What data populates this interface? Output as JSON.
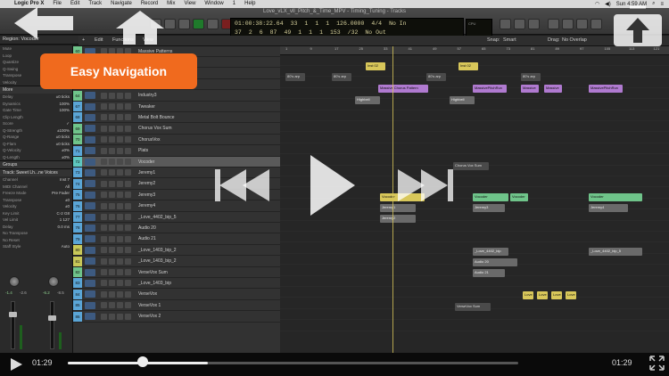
{
  "menubar": {
    "items": [
      "Logic Pro X",
      "File",
      "Edit",
      "Track",
      "Navigate",
      "Record",
      "Mix",
      "View",
      "Window",
      "1",
      "Help"
    ],
    "clock": "Sun 4:59 AM"
  },
  "window": {
    "title": "Love_vLX_vll_Pitch_&_Time_MPV - Timing_Tuning - Tracks"
  },
  "lcd": {
    "row1": [
      "01:00:38:22.64",
      "33",
      "1",
      "1",
      "1",
      "126.0000",
      "4/4",
      "No In"
    ],
    "row2": [
      "37",
      "2",
      "6",
      "87",
      "49",
      "1",
      "1",
      "1",
      "153",
      "/32",
      "No Out"
    ],
    "cpu_label": "CPU"
  },
  "inspector": {
    "region_label": "Region: Vocoder",
    "params": [
      {
        "k": "Mute",
        "v": ""
      },
      {
        "k": "Loop",
        "v": ""
      },
      {
        "k": "Quantize",
        "v": "off"
      },
      {
        "k": "Q-Swing",
        "v": ""
      },
      {
        "k": "Transpose",
        "v": ""
      },
      {
        "k": "Velocity",
        "v": "±0"
      }
    ],
    "more_label": "More",
    "more_params": [
      {
        "k": "Delay",
        "v": "±0 ticks"
      },
      {
        "k": "Dynamics",
        "v": "100%"
      },
      {
        "k": "Gate Time",
        "v": "100%"
      },
      {
        "k": "Clip Length",
        "v": ""
      },
      {
        "k": "Score",
        "v": "✓"
      },
      {
        "k": "Q-Strength",
        "v": "±100%"
      },
      {
        "k": "Q-Range",
        "v": "±0 ticks"
      },
      {
        "k": "Q-Flam",
        "v": "±0 ticks"
      },
      {
        "k": "Q-Velocity",
        "v": "±0%"
      },
      {
        "k": "Q-Length",
        "v": "±0%"
      }
    ],
    "groups_label": "Groups",
    "track_label": "Track: Sweet Lh...ne Voices",
    "track_params": [
      {
        "k": "Channel",
        "v": "Inst 7"
      },
      {
        "k": "MIDI Channel",
        "v": "All"
      },
      {
        "k": "Freeze Mode",
        "v": "Pre Fader"
      },
      {
        "k": "Transpose",
        "v": "±0"
      },
      {
        "k": "Velocity",
        "v": "±0"
      },
      {
        "k": "Key Limit",
        "v": "C-2   G8"
      },
      {
        "k": "Vel Limit",
        "v": "1   127"
      },
      {
        "k": "Delay",
        "v": "0.0 ms"
      },
      {
        "k": "No Transpose",
        "v": ""
      },
      {
        "k": "No Reset",
        "v": ""
      },
      {
        "k": "Staff Style",
        "v": "Auto"
      }
    ],
    "meters": {
      "left_val": "-1.4",
      "left_val2": "-2.6",
      "right_val": "-6.2",
      "right_val2": "-8.5",
      "left_fill": 0.55,
      "right_fill": 0.38
    }
  },
  "toolbar": {
    "edit": "Edit",
    "functions": "Functions",
    "view": "View",
    "snap_label": "Snap:",
    "snap_value": "Smart",
    "drag_label": "Drag:",
    "drag_value": "No Overlap"
  },
  "ruler": {
    "marks": [
      "1",
      "9",
      "17",
      "25",
      "33",
      "41",
      "49",
      "57",
      "65",
      "73",
      "81",
      "89",
      "97",
      "105",
      "113",
      "121"
    ]
  },
  "tracks": [
    {
      "num": "60",
      "name": "Massive Patterns",
      "color": "#6fc48a"
    },
    {
      "num": "61",
      "name": "Highbell",
      "color": "#6fc48a"
    },
    {
      "num": "62",
      "name": "Industry1",
      "color": "#6fc48a"
    },
    {
      "num": "63",
      "name": "Industry2",
      "color": "#6fc48a"
    },
    {
      "num": "64",
      "name": "Industry3",
      "color": "#6fc48a"
    },
    {
      "num": "67",
      "name": "Tweaker",
      "color": "#5aa5d6"
    },
    {
      "num": "68",
      "name": "Metal Bolt Bounce",
      "color": "#5aa5d6"
    },
    {
      "num": "69",
      "name": "Chorus Vox Sum",
      "color": "#6fc48a"
    },
    {
      "num": "70",
      "name": "ChorusVox",
      "color": "#6fc48a"
    },
    {
      "num": "71",
      "name": "Plats",
      "color": "#5aa5d6"
    },
    {
      "num": "72",
      "name": "Vocoder",
      "color": "#5ec8c0"
    },
    {
      "num": "73",
      "name": "Jeremy1",
      "color": "#5aa5d6"
    },
    {
      "num": "74",
      "name": "Jeremy2",
      "color": "#5aa5d6"
    },
    {
      "num": "75",
      "name": "Jeremy3",
      "color": "#5aa5d6"
    },
    {
      "num": "76",
      "name": "Jeremy4",
      "color": "#5aa5d6"
    },
    {
      "num": "77",
      "name": "_Love_4402_bip_5",
      "color": "#5aa5d6"
    },
    {
      "num": "78",
      "name": "Audio 20",
      "color": "#5aa5d6"
    },
    {
      "num": "79",
      "name": "Audio 21",
      "color": "#5aa5d6"
    },
    {
      "num": "80",
      "name": "_Love_1403_bip_2",
      "color": "#c8c858"
    },
    {
      "num": "81",
      "name": "_Love_1403_bip_2",
      "color": "#c8c858"
    },
    {
      "num": "82",
      "name": "VerseVox Sum",
      "color": "#6fc48a"
    },
    {
      "num": "83",
      "name": "_Love_1403_bip",
      "color": "#5aa5d6"
    },
    {
      "num": "84",
      "name": "VerseVox",
      "color": "#5aa5d6"
    },
    {
      "num": "85",
      "name": "VerseVox 1",
      "color": "#5aa5d6"
    },
    {
      "num": "86",
      "name": "VerseVox 2",
      "color": "#5aa5d6"
    }
  ],
  "regions": {
    "inst02a": "Inst 02",
    "inst02b": "Inst 02",
    "r80s1": "80's arp",
    "r80s2": "80's arp",
    "r80s3": "80's arp",
    "r80s4": "80's arp",
    "massive1": "Massive Chorus Pattern",
    "massive2": "MassivePitchRun",
    "massive3": "Massive",
    "massive4": "Massive",
    "massive5": "MassivePitchRun",
    "highbell1": "Highbell",
    "highbell2": "Highbell",
    "chorusvox": "Chorus Vox Sum",
    "vocoder1": "Vocoder",
    "vocoder2": "Vocoder",
    "vocoder3": "Vocoder",
    "vocoder4": "Vocoder",
    "jeremy1": "Jeremy1",
    "jeremy2": "Jeremy2",
    "jeremy3": "Jeremy3",
    "jeremy4": "Jeremy4",
    "love4402a": "_Love_4402_bip",
    "love4402b": "_Love_4402_bip_5",
    "audio20": "Audio 20",
    "audio21": "Audio 21",
    "versevox": "VerseVox Sum",
    "love1": "Love",
    "love2": "Love",
    "love3": "Love",
    "love4": "Love"
  },
  "overlay": {
    "banner": "Easy Navigation",
    "time_current": "01:29",
    "time_duration": "01:29",
    "progress": 0.31
  }
}
